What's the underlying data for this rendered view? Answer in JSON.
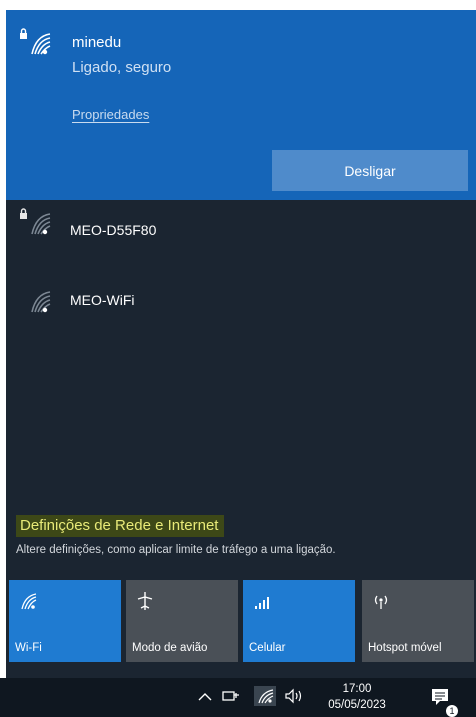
{
  "connected_network": {
    "ssid": "minedu",
    "status": "Ligado, seguro",
    "properties_link": "Propriedades",
    "disconnect_button": "Desligar",
    "icon": "wifi-secured-icon"
  },
  "available_networks": [
    {
      "ssid": "MEO-D55F80",
      "secured": true,
      "icon": "wifi-secured-icon"
    },
    {
      "ssid": "MEO-WiFi",
      "secured": false,
      "icon": "wifi-icon"
    }
  ],
  "settings": {
    "title": "Definições de Rede e Internet",
    "description": "Altere definições, como aplicar limite de tráfego a uma ligação."
  },
  "quick_actions": [
    {
      "label": "Wi-Fi",
      "active": true,
      "icon": "wifi-icon"
    },
    {
      "label": "Modo de avião",
      "active": false,
      "icon": "airplane-icon"
    },
    {
      "label": "Celular",
      "active": true,
      "icon": "cellular-icon"
    },
    {
      "label": "Hotspot móvel",
      "active": false,
      "icon": "hotspot-icon"
    }
  ],
  "taskbar": {
    "time": "17:00",
    "date": "05/05/2023",
    "notification_count": "1"
  },
  "colors": {
    "accent": "#1f7bd1",
    "connected_bg": "#1565b8",
    "panel_bg": "#1b2531",
    "highlight": "#e8ea78"
  }
}
